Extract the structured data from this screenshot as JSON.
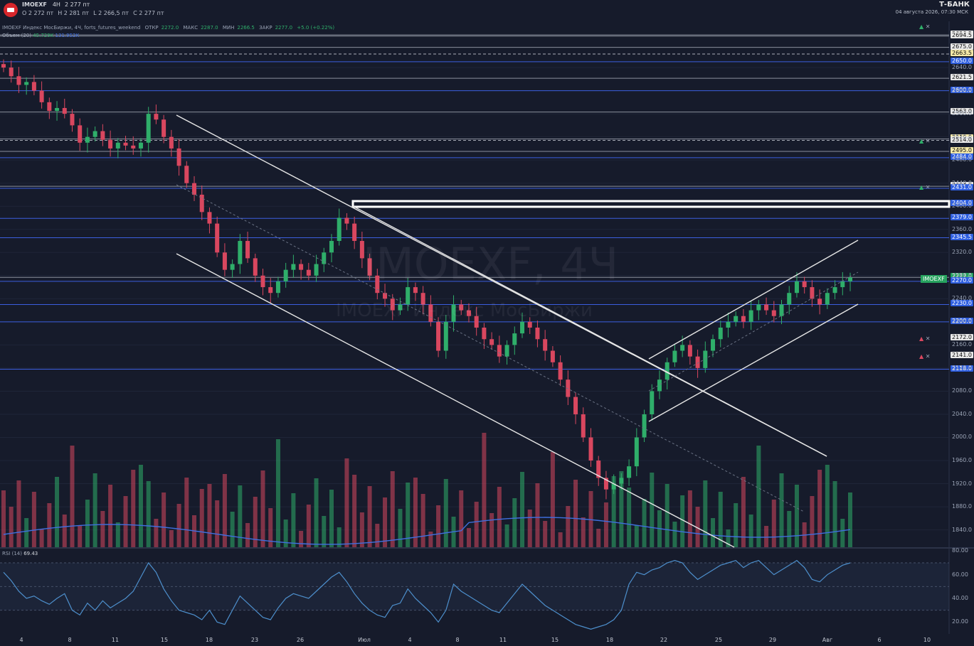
{
  "header": {
    "symbol": "IMOEXF",
    "timeframe": "4H",
    "last": "2 277 пт",
    "open": "O 2 272 пт",
    "high": "H 2 281 пт",
    "low": "L 2 266,5 пт",
    "close": "C 2 277 пт",
    "brand": "Т-БАНК",
    "datetime": "04 августа 2026, 07:30 МСК"
  },
  "legend": {
    "name": "IMOEXF Индекс МосБиржи, 4Ч, forts_futures_weekend",
    "open": "ОТКР",
    "open_v": "2272.0",
    "high": "МАКС",
    "high_v": "2287.0",
    "low": "МИН",
    "low_v": "2266.5",
    "close": "ЗАКР",
    "close_v": "2277.0",
    "change": "+5.0 (+0.22%)",
    "volume_label": "Объем (20)",
    "volume_v1": "45.729K",
    "volume_v2": "131.952K"
  },
  "watermark": {
    "big": "IMOEXF, 4Ч",
    "small": "IMOEXF Индекс МосБиржи"
  },
  "rsi": {
    "label": "RSI (14)",
    "value": "69.43"
  },
  "symbol_tag": "IMOEXF",
  "colors": {
    "bg": "#161b2b",
    "up": "#2fae6a",
    "down": "#d9475f",
    "hline": "#3b5ede",
    "volume_ma": "#3f6fe0",
    "rsi": "#4d8fcc",
    "channel": "#e6e6e6"
  },
  "chart_data": [
    {
      "type": "candlestick",
      "title": "IMOEXF, 4Ч",
      "ylim": [
        1810,
        2720
      ],
      "x_ticks": [
        "4",
        "8",
        "11",
        "15",
        "18",
        "23",
        "26",
        "Июл",
        "4",
        "8",
        "11",
        "15",
        "18",
        "22",
        "25",
        "29",
        "Авг",
        "6",
        "10"
      ],
      "y_ticks": [
        1840,
        1880,
        1920,
        1960,
        2000,
        2040,
        2080,
        2120,
        2160,
        2200,
        2240,
        2280,
        2320,
        2360,
        2400,
        2440,
        2480,
        2520,
        2560,
        2600,
        2640
      ],
      "price_levels": [
        {
          "label": "2696.5",
          "style": "solid",
          "tag": "plain"
        },
        {
          "label": "2694.5",
          "style": "solid",
          "tag": "plain"
        },
        {
          "label": "2675.0",
          "style": "solid",
          "tag": "plain"
        },
        {
          "label": "2663.5",
          "style": "dashed",
          "tag": "yellow"
        },
        {
          "label": "2650.0",
          "style": "blue",
          "tag": "blue"
        },
        {
          "label": "2621.5",
          "style": "solid",
          "tag": "plain"
        },
        {
          "label": "2600.0",
          "style": "blue",
          "tag": "blue"
        },
        {
          "label": "2563.0",
          "style": "solid",
          "tag": "plain"
        },
        {
          "label": "2516.5",
          "style": "solid",
          "tag": "yellow"
        },
        {
          "label": "2514.0",
          "style": "dashed",
          "tag": "plain"
        },
        {
          "label": "2495.0",
          "style": "solid",
          "tag": "yellow"
        },
        {
          "label": "2484.0",
          "style": "blue",
          "tag": "blue"
        },
        {
          "label": "2434.5",
          "style": "solid",
          "tag": "plain"
        },
        {
          "label": "2431.0",
          "style": "blue",
          "tag": "blue"
        },
        {
          "label": "2404.0",
          "style": "white",
          "tag": "blue"
        },
        {
          "label": "2379.0",
          "style": "blue",
          "tag": "blue"
        },
        {
          "label": "2345.5",
          "style": "blue",
          "tag": "blue"
        },
        {
          "label": "2277.0",
          "style": "solid",
          "tag": "green"
        },
        {
          "label": "2270.0",
          "style": "blue",
          "tag": "blue"
        },
        {
          "label": "2230.0",
          "style": "blue",
          "tag": "blue"
        },
        {
          "label": "2200.0",
          "style": "blue",
          "tag": "blue"
        },
        {
          "label": "2172.0",
          "style": "none",
          "tag": "plain"
        },
        {
          "label": "2141.0",
          "style": "none",
          "tag": "plain"
        },
        {
          "label": "2118.0",
          "style": "blue",
          "tag": "blue"
        }
      ],
      "candles_close": [
        2640,
        2625,
        2610,
        2615,
        2600,
        2580,
        2565,
        2570,
        2560,
        2540,
        2510,
        2520,
        2530,
        2515,
        2500,
        2510,
        2505,
        2500,
        2510,
        2560,
        2550,
        2520,
        2500,
        2470,
        2440,
        2420,
        2390,
        2370,
        2320,
        2290,
        2300,
        2340,
        2310,
        2280,
        2260,
        2250,
        2270,
        2290,
        2300,
        2290,
        2280,
        2300,
        2320,
        2340,
        2380,
        2370,
        2340,
        2310,
        2280,
        2250,
        2240,
        2220,
        2230,
        2260,
        2250,
        2230,
        2200,
        2150,
        2200,
        2230,
        2220,
        2210,
        2190,
        2170,
        2160,
        2140,
        2160,
        2180,
        2200,
        2190,
        2170,
        2150,
        2130,
        2100,
        2070,
        2040,
        2000,
        1960,
        1930,
        1910,
        1920,
        1930,
        1950,
        2000,
        2040,
        2080,
        2100,
        2130,
        2150,
        2160,
        2140,
        2120,
        2150,
        2170,
        2190,
        2200,
        2210,
        2200,
        2220,
        2230,
        2220,
        2210,
        2230,
        2250,
        2270,
        2260,
        2240,
        2230,
        2250,
        2260,
        2270,
        2277
      ],
      "volume_ma_label": "Объем (20)"
    },
    {
      "type": "line",
      "title": "RSI (14)",
      "ylim": [
        10,
        82
      ],
      "y_ticks": [
        20,
        40,
        60,
        80
      ],
      "values": [
        62,
        55,
        46,
        40,
        42,
        38,
        35,
        40,
        44,
        30,
        26,
        36,
        30,
        38,
        32,
        36,
        40,
        46,
        58,
        70,
        62,
        48,
        38,
        30,
        28,
        26,
        22,
        30,
        20,
        18,
        30,
        42,
        36,
        30,
        24,
        22,
        32,
        40,
        44,
        42,
        40,
        46,
        52,
        58,
        62,
        54,
        44,
        36,
        30,
        26,
        24,
        34,
        36,
        48,
        40,
        34,
        28,
        20,
        30,
        52,
        46,
        42,
        38,
        34,
        30,
        28,
        36,
        44,
        52,
        46,
        40,
        34,
        30,
        26,
        22,
        18,
        16,
        14,
        16,
        18,
        22,
        30,
        52,
        62,
        60,
        64,
        66,
        70,
        72,
        70,
        62,
        56,
        60,
        64,
        68,
        70,
        72,
        66,
        70,
        72,
        66,
        60,
        64,
        68,
        72,
        66,
        56,
        54,
        60,
        64,
        68,
        70
      ]
    }
  ]
}
